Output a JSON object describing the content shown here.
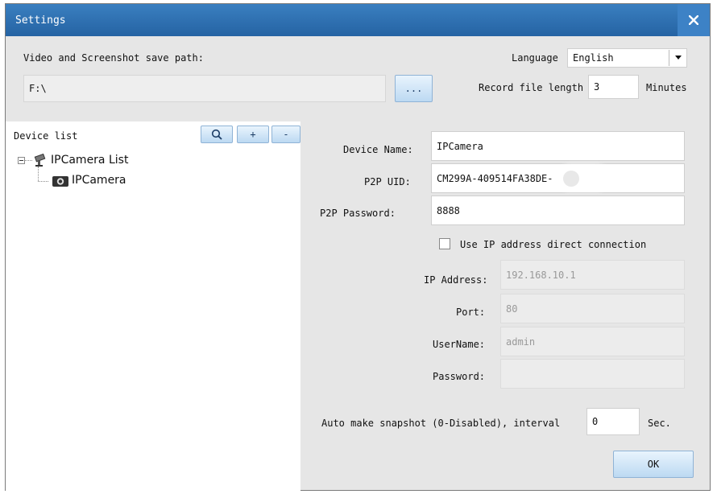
{
  "window": {
    "title": "Settings"
  },
  "top": {
    "save_path_label": "Video and Screenshot save path:",
    "save_path_value": "F:\\",
    "browse_label": "...",
    "language_label": "Language",
    "language_value": "English",
    "record_length_label": "Record file length",
    "record_length_value": "3",
    "record_length_unit": "Minutes"
  },
  "device_list": {
    "header": "Device list",
    "add_label": "+",
    "remove_label": "-",
    "tree": {
      "root": "IPCamera List",
      "child": "IPCamera"
    }
  },
  "form": {
    "device_name_label": "Device Name:",
    "device_name_value": "IPCamera",
    "p2p_uid_label": "P2P UID:",
    "p2p_uid_value": "CM299A-409514FA38DE-",
    "p2p_password_label": "P2P Password:",
    "p2p_password_value": "8888",
    "direct_connection_label": "Use IP address direct connection",
    "ip_label": "IP Address:",
    "ip_value": "192.168.10.1",
    "port_label": "Port:",
    "port_value": "80",
    "username_label": "UserName:",
    "username_value": "admin",
    "password_label": "Password:",
    "password_value": "",
    "snapshot_label": "Auto make snapshot (0-Disabled), interval",
    "snapshot_value": "0",
    "snapshot_unit": "Sec.",
    "ok_label": "OK"
  }
}
